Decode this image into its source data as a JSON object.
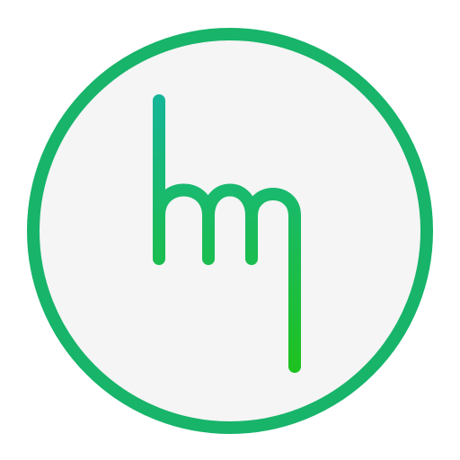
{
  "icon": {
    "name": "hm-monogram-icon",
    "description_glyph": "hm",
    "ring_color": "#17b46a",
    "background_color": "#f5f5f5",
    "stroke_gradient_top": "#16b597",
    "stroke_gradient_bottom": "#1ec21f"
  }
}
